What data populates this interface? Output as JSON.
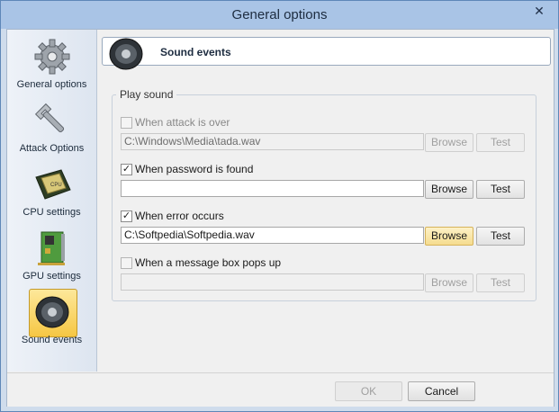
{
  "window": {
    "title": "General options",
    "close_glyph": "✕"
  },
  "sidebar": {
    "items": [
      {
        "label": "General options",
        "icon": "gear-icon"
      },
      {
        "label": "Attack Options",
        "icon": "wrench-icon"
      },
      {
        "label": "CPU settings",
        "icon": "cpu-chip-icon"
      },
      {
        "label": "GPU settings",
        "icon": "gpu-card-icon"
      },
      {
        "label": "Sound events",
        "icon": "speaker-icon",
        "selected": true
      }
    ]
  },
  "header": {
    "title": "Sound events",
    "icon": "speaker-icon"
  },
  "group": {
    "legend": "Play sound"
  },
  "events": [
    {
      "label": "When attack is over",
      "checked": false,
      "enabled": false,
      "path": "C:\\Windows\\Media\\tada.wav",
      "browse": "Browse",
      "test": "Test"
    },
    {
      "label": "When password is found",
      "checked": true,
      "enabled": true,
      "path": "",
      "browse": "Browse",
      "test": "Test"
    },
    {
      "label": "When error occurs",
      "checked": true,
      "enabled": true,
      "path": "C:\\Softpedia\\Softpedia.wav",
      "browse": "Browse",
      "test": "Test",
      "browse_hover": true
    },
    {
      "label": "When a message box pops up",
      "checked": false,
      "enabled": false,
      "path": "",
      "browse": "Browse",
      "test": "Test"
    }
  ],
  "footer": {
    "ok_label": "OK",
    "ok_enabled": false,
    "cancel_label": "Cancel"
  },
  "colors": {
    "title_bar": "#a9c4e6",
    "selected_highlight": "#f6c744",
    "border": "#5e87b8"
  }
}
